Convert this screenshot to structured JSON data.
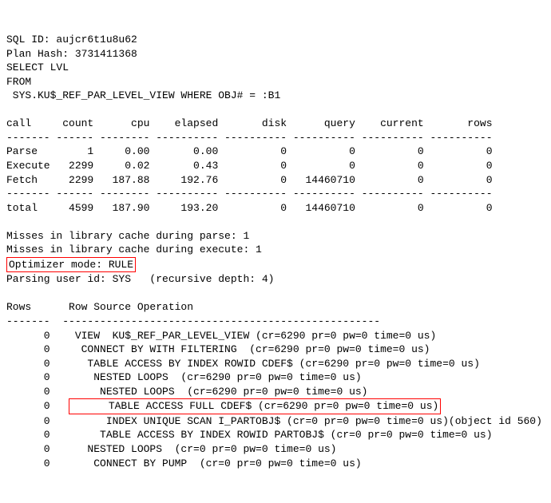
{
  "header": {
    "sql_id_label": "SQL ID: ",
    "sql_id": "aujcr6t1u8u62",
    "plan_hash_label": "Plan Hash: ",
    "plan_hash": "3731411368",
    "select_line": "SELECT LVL",
    "from_line": "FROM",
    "where_line": " SYS.KU$_REF_PAR_LEVEL_VIEW WHERE OBJ# = :B1"
  },
  "table": {
    "cols": [
      "call",
      "count",
      "cpu",
      "elapsed",
      "disk",
      "query",
      "current",
      "rows"
    ],
    "dashes": [
      "-------",
      "------",
      "--------",
      "----------",
      "----------",
      "----------",
      "----------",
      "----------"
    ],
    "rows": [
      {
        "c0": "Parse",
        "c1": "1",
        "c2": "0.00",
        "c3": "0.00",
        "c4": "0",
        "c5": "0",
        "c6": "0",
        "c7": "0"
      },
      {
        "c0": "Execute",
        "c1": "2299",
        "c2": "0.02",
        "c3": "0.43",
        "c4": "0",
        "c5": "0",
        "c6": "0",
        "c7": "0"
      },
      {
        "c0": "Fetch",
        "c1": "2299",
        "c2": "187.88",
        "c3": "192.76",
        "c4": "0",
        "c5": "14460710",
        "c6": "0",
        "c7": "0"
      }
    ],
    "total": {
      "c0": "total",
      "c1": "4599",
      "c2": "187.90",
      "c3": "193.20",
      "c4": "0",
      "c5": "14460710",
      "c6": "0",
      "c7": "0"
    }
  },
  "misc": {
    "miss_parse": "Misses in library cache during parse: 1",
    "miss_exec": "Misses in library cache during execute: 1",
    "opt_mode": "Optimizer mode: RULE",
    "parsing_user": "Parsing user id: SYS   (recursive depth: 4)"
  },
  "plan": {
    "header_rows": "Rows",
    "header_op": "Row Source Operation",
    "dash_rows": "-------",
    "dash_op": "---------------------------------------------------",
    "lines": [
      {
        "rows": "0",
        "op": "VIEW  KU$_REF_PAR_LEVEL_VIEW (cr=6290 pr=0 pw=0 time=0 us)",
        "indent": 1,
        "hl": false
      },
      {
        "rows": "0",
        "op": "CONNECT BY WITH FILTERING  (cr=6290 pr=0 pw=0 time=0 us)",
        "indent": 2,
        "hl": false
      },
      {
        "rows": "0",
        "op": "TABLE ACCESS BY INDEX ROWID CDEF$ (cr=6290 pr=0 pw=0 time=0 us)",
        "indent": 3,
        "hl": false
      },
      {
        "rows": "0",
        "op": "NESTED LOOPS  (cr=6290 pr=0 pw=0 time=0 us)",
        "indent": 4,
        "hl": false
      },
      {
        "rows": "0",
        "op": "NESTED LOOPS  (cr=6290 pr=0 pw=0 time=0 us)",
        "indent": 5,
        "hl": false
      },
      {
        "rows": "0",
        "op": "TABLE ACCESS FULL CDEF$ (cr=6290 pr=0 pw=0 time=0 us)",
        "indent": 6,
        "hl": true
      },
      {
        "rows": "0",
        "op": "INDEX UNIQUE SCAN I_PARTOBJ$ (cr=0 pr=0 pw=0 time=0 us)(object id 560)",
        "indent": 6,
        "hl": false
      },
      {
        "rows": "0",
        "op": "TABLE ACCESS BY INDEX ROWID PARTOBJ$ (cr=0 pr=0 pw=0 time=0 us)",
        "indent": 5,
        "hl": false
      },
      {
        "rows": "0",
        "op": "NESTED LOOPS  (cr=0 pr=0 pw=0 time=0 us)",
        "indent": 3,
        "hl": false
      },
      {
        "rows": "0",
        "op": "CONNECT BY PUMP  (cr=0 pr=0 pw=0 time=0 us)",
        "indent": 4,
        "hl": false
      }
    ]
  }
}
